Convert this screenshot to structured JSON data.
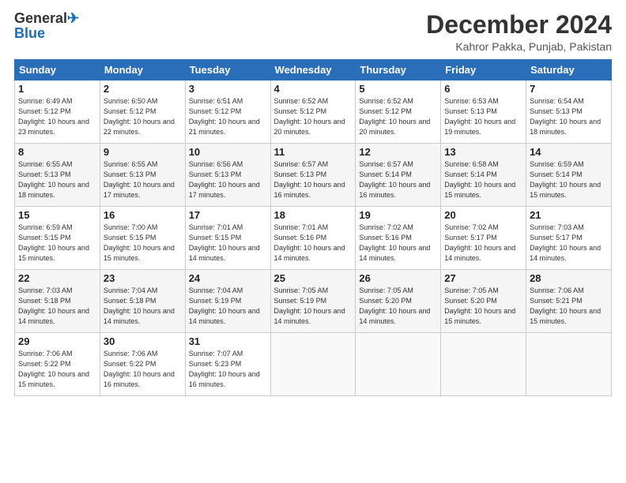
{
  "logo": {
    "line1": "General",
    "line2": "Blue"
  },
  "title": "December 2024",
  "subtitle": "Kahror Pakka, Punjab, Pakistan",
  "days_header": [
    "Sunday",
    "Monday",
    "Tuesday",
    "Wednesday",
    "Thursday",
    "Friday",
    "Saturday"
  ],
  "weeks": [
    [
      {
        "day": "1",
        "sunrise": "Sunrise: 6:49 AM",
        "sunset": "Sunset: 5:12 PM",
        "daylight": "Daylight: 10 hours and 23 minutes."
      },
      {
        "day": "2",
        "sunrise": "Sunrise: 6:50 AM",
        "sunset": "Sunset: 5:12 PM",
        "daylight": "Daylight: 10 hours and 22 minutes."
      },
      {
        "day": "3",
        "sunrise": "Sunrise: 6:51 AM",
        "sunset": "Sunset: 5:12 PM",
        "daylight": "Daylight: 10 hours and 21 minutes."
      },
      {
        "day": "4",
        "sunrise": "Sunrise: 6:52 AM",
        "sunset": "Sunset: 5:12 PM",
        "daylight": "Daylight: 10 hours and 20 minutes."
      },
      {
        "day": "5",
        "sunrise": "Sunrise: 6:52 AM",
        "sunset": "Sunset: 5:12 PM",
        "daylight": "Daylight: 10 hours and 20 minutes."
      },
      {
        "day": "6",
        "sunrise": "Sunrise: 6:53 AM",
        "sunset": "Sunset: 5:13 PM",
        "daylight": "Daylight: 10 hours and 19 minutes."
      },
      {
        "day": "7",
        "sunrise": "Sunrise: 6:54 AM",
        "sunset": "Sunset: 5:13 PM",
        "daylight": "Daylight: 10 hours and 18 minutes."
      }
    ],
    [
      {
        "day": "8",
        "sunrise": "Sunrise: 6:55 AM",
        "sunset": "Sunset: 5:13 PM",
        "daylight": "Daylight: 10 hours and 18 minutes."
      },
      {
        "day": "9",
        "sunrise": "Sunrise: 6:55 AM",
        "sunset": "Sunset: 5:13 PM",
        "daylight": "Daylight: 10 hours and 17 minutes."
      },
      {
        "day": "10",
        "sunrise": "Sunrise: 6:56 AM",
        "sunset": "Sunset: 5:13 PM",
        "daylight": "Daylight: 10 hours and 17 minutes."
      },
      {
        "day": "11",
        "sunrise": "Sunrise: 6:57 AM",
        "sunset": "Sunset: 5:13 PM",
        "daylight": "Daylight: 10 hours and 16 minutes."
      },
      {
        "day": "12",
        "sunrise": "Sunrise: 6:57 AM",
        "sunset": "Sunset: 5:14 PM",
        "daylight": "Daylight: 10 hours and 16 minutes."
      },
      {
        "day": "13",
        "sunrise": "Sunrise: 6:58 AM",
        "sunset": "Sunset: 5:14 PM",
        "daylight": "Daylight: 10 hours and 15 minutes."
      },
      {
        "day": "14",
        "sunrise": "Sunrise: 6:59 AM",
        "sunset": "Sunset: 5:14 PM",
        "daylight": "Daylight: 10 hours and 15 minutes."
      }
    ],
    [
      {
        "day": "15",
        "sunrise": "Sunrise: 6:59 AM",
        "sunset": "Sunset: 5:15 PM",
        "daylight": "Daylight: 10 hours and 15 minutes."
      },
      {
        "day": "16",
        "sunrise": "Sunrise: 7:00 AM",
        "sunset": "Sunset: 5:15 PM",
        "daylight": "Daylight: 10 hours and 15 minutes."
      },
      {
        "day": "17",
        "sunrise": "Sunrise: 7:01 AM",
        "sunset": "Sunset: 5:15 PM",
        "daylight": "Daylight: 10 hours and 14 minutes."
      },
      {
        "day": "18",
        "sunrise": "Sunrise: 7:01 AM",
        "sunset": "Sunset: 5:16 PM",
        "daylight": "Daylight: 10 hours and 14 minutes."
      },
      {
        "day": "19",
        "sunrise": "Sunrise: 7:02 AM",
        "sunset": "Sunset: 5:16 PM",
        "daylight": "Daylight: 10 hours and 14 minutes."
      },
      {
        "day": "20",
        "sunrise": "Sunrise: 7:02 AM",
        "sunset": "Sunset: 5:17 PM",
        "daylight": "Daylight: 10 hours and 14 minutes."
      },
      {
        "day": "21",
        "sunrise": "Sunrise: 7:03 AM",
        "sunset": "Sunset: 5:17 PM",
        "daylight": "Daylight: 10 hours and 14 minutes."
      }
    ],
    [
      {
        "day": "22",
        "sunrise": "Sunrise: 7:03 AM",
        "sunset": "Sunset: 5:18 PM",
        "daylight": "Daylight: 10 hours and 14 minutes."
      },
      {
        "day": "23",
        "sunrise": "Sunrise: 7:04 AM",
        "sunset": "Sunset: 5:18 PM",
        "daylight": "Daylight: 10 hours and 14 minutes."
      },
      {
        "day": "24",
        "sunrise": "Sunrise: 7:04 AM",
        "sunset": "Sunset: 5:19 PM",
        "daylight": "Daylight: 10 hours and 14 minutes."
      },
      {
        "day": "25",
        "sunrise": "Sunrise: 7:05 AM",
        "sunset": "Sunset: 5:19 PM",
        "daylight": "Daylight: 10 hours and 14 minutes."
      },
      {
        "day": "26",
        "sunrise": "Sunrise: 7:05 AM",
        "sunset": "Sunset: 5:20 PM",
        "daylight": "Daylight: 10 hours and 14 minutes."
      },
      {
        "day": "27",
        "sunrise": "Sunrise: 7:05 AM",
        "sunset": "Sunset: 5:20 PM",
        "daylight": "Daylight: 10 hours and 15 minutes."
      },
      {
        "day": "28",
        "sunrise": "Sunrise: 7:06 AM",
        "sunset": "Sunset: 5:21 PM",
        "daylight": "Daylight: 10 hours and 15 minutes."
      }
    ],
    [
      {
        "day": "29",
        "sunrise": "Sunrise: 7:06 AM",
        "sunset": "Sunset: 5:22 PM",
        "daylight": "Daylight: 10 hours and 15 minutes."
      },
      {
        "day": "30",
        "sunrise": "Sunrise: 7:06 AM",
        "sunset": "Sunset: 5:22 PM",
        "daylight": "Daylight: 10 hours and 16 minutes."
      },
      {
        "day": "31",
        "sunrise": "Sunrise: 7:07 AM",
        "sunset": "Sunset: 5:23 PM",
        "daylight": "Daylight: 10 hours and 16 minutes."
      },
      null,
      null,
      null,
      null
    ]
  ]
}
